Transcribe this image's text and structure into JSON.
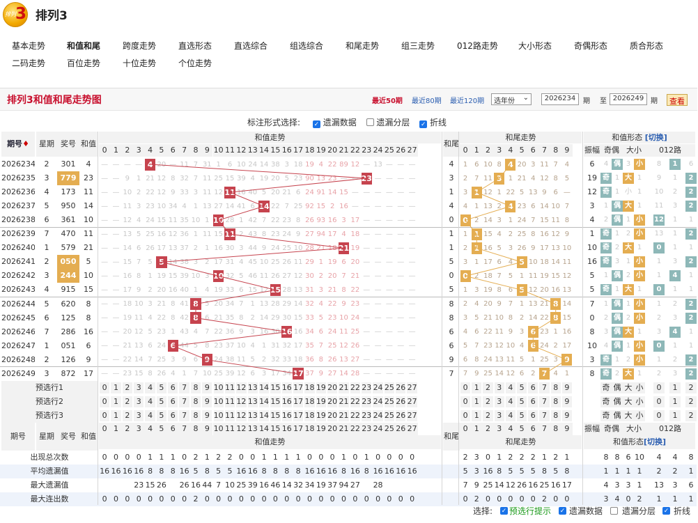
{
  "logo": {
    "text": "排列",
    "num": "3"
  },
  "title": "排列3",
  "nav": {
    "row1": [
      "基本走势",
      "和值和尾",
      "跨度走势",
      "直选形态",
      "直选综合",
      "组选综合",
      "和尾走势",
      "组三走势",
      "012路走势",
      "大小形态",
      "奇偶形态",
      "质合形态"
    ],
    "row2": [
      "二码走势",
      "百位走势",
      "十位走势",
      "个位走势"
    ],
    "active": "和值和尾"
  },
  "panel": {
    "title": "排列3和值和尾走势图",
    "links": [
      "最近50期",
      "最近80期",
      "最近120期"
    ],
    "year": "选年份",
    "from": "2026234",
    "to": "2026249",
    "qi1": "期",
    "zhi": "至",
    "qi2": "期",
    "go": "查看"
  },
  "options": {
    "label": "标注形式选择:",
    "cb1": "遗漏数据",
    "cb2": "遗漏分层",
    "cb3": "折线"
  },
  "headers": {
    "period": "期号",
    "week": "星期",
    "num": "奖号",
    "sum": "和值",
    "sumtrend": "和值走势",
    "tail": "和尾",
    "tailtrend": "和尾走势",
    "form": "和值形态",
    "switch": "[切换]",
    "amp": "振幅",
    "oddeven": "奇偶",
    "bigsmall": "大小",
    "road": "012路"
  },
  "rows": [
    {
      "p": "2026234",
      "w": "2",
      "n": "301",
      "s": "4",
      "st": [
        "—",
        "—",
        "—",
        "—",
        "4",
        "20",
        "—",
        "11",
        "7",
        "31",
        "1",
        "6",
        "10",
        "24",
        "14",
        "38",
        "3",
        "18",
        "19",
        "4",
        "22",
        "89",
        "12",
        "—",
        "13",
        "—",
        "—",
        "—"
      ],
      "t": "4",
      "tt": [
        "1",
        "6",
        "10",
        "8",
        "4",
        "20",
        "3",
        "11",
        "7",
        "4"
      ],
      "amp": "6",
      "oe": "4",
      "oep": "偶",
      "bs": "3",
      "bsp": "小",
      "r": [
        "8",
        "1",
        "6"
      ],
      "rk": 1
    },
    {
      "p": "2026235",
      "w": "3",
      "n": "779",
      "s": "23",
      "st": [
        "—",
        "—",
        "9",
        "1",
        "21",
        "12",
        "8",
        "32",
        "7",
        "11",
        "25",
        "15",
        "39",
        "4",
        "19",
        "20",
        "5",
        "23",
        "90",
        "13",
        "23",
        "—",
        "—",
        "—",
        "—",
        "—",
        "—",
        "—"
      ],
      "t": "3",
      "tt": [
        "2",
        "7",
        "11",
        "3",
        "1",
        "21",
        "4",
        "12",
        "8",
        "5"
      ],
      "amp": "19",
      "oe": "奇",
      "oep": "1",
      "bs": "大",
      "bsp": "1",
      "r": [
        "9",
        "1",
        "2"
      ],
      "rk": 2
    },
    {
      "p": "2026236",
      "w": "4",
      "n": "173",
      "s": "11",
      "st": [
        "—",
        "—",
        "10",
        "2",
        "22",
        "12",
        "9",
        "33",
        "3",
        "11",
        "12",
        "26",
        "16",
        "40",
        "5",
        "20",
        "21",
        "6",
        "24",
        "91",
        "14",
        "15",
        "—",
        "—",
        "—",
        "—",
        "—",
        "—"
      ],
      "t": "1",
      "tt": [
        "3",
        "1",
        "12",
        "1",
        "22",
        "5",
        "13",
        "9",
        "6",
        "—"
      ],
      "amp": "12",
      "oe": "奇",
      "oep": "1",
      "bs": "小",
      "bsp": "1",
      "r": [
        "10",
        "2",
        "2"
      ],
      "rk": 2
    },
    {
      "p": "2026237",
      "w": "5",
      "n": "950",
      "s": "14",
      "st": [
        "—",
        "—",
        "11",
        "3",
        "23",
        "10",
        "34",
        "4",
        "1",
        "13",
        "27",
        "14",
        "41",
        "6",
        "21",
        "22",
        "7",
        "25",
        "92",
        "15",
        "2",
        "16",
        "—",
        "—",
        "—",
        "—",
        "—",
        "—"
      ],
      "t": "4",
      "tt": [
        "4",
        "1",
        "13",
        "2",
        "4",
        "23",
        "6",
        "14",
        "10",
        "7"
      ],
      "amp": "3",
      "oe": "1",
      "oep": "偶",
      "bs": "大",
      "bsp": "1",
      "r": [
        "11",
        "3",
        "2"
      ],
      "rk": 2
    },
    {
      "p": "2026238",
      "w": "6",
      "n": "361",
      "s": "10",
      "st": [
        "—",
        "—",
        "12",
        "4",
        "24",
        "15",
        "11",
        "35",
        "10",
        "1",
        "14",
        "28",
        "1",
        "42",
        "7",
        "22",
        "23",
        "8",
        "26",
        "93",
        "16",
        "3",
        "17",
        "—",
        "—",
        "—",
        "—",
        "—"
      ],
      "t": "0",
      "tt": [
        "0",
        "2",
        "14",
        "3",
        "1",
        "24",
        "7",
        "15",
        "11",
        "8"
      ],
      "amp": "4",
      "oe": "2",
      "oep": "偶",
      "bs": "1",
      "bsp": "小",
      "r": [
        "12",
        "1",
        "1"
      ],
      "rk": 0
    },
    {
      "p": "2026239",
      "w": "7",
      "n": "470",
      "s": "11",
      "st": [
        "—",
        "—",
        "13",
        "5",
        "25",
        "16",
        "12",
        "36",
        "1",
        "11",
        "15",
        "29",
        "2",
        "43",
        "8",
        "23",
        "24",
        "9",
        "27",
        "94",
        "17",
        "4",
        "18",
        "—",
        "—",
        "—",
        "—",
        "—"
      ],
      "t": "1",
      "tt": [
        "1",
        "1",
        "15",
        "4",
        "2",
        "25",
        "8",
        "16",
        "12",
        "9"
      ],
      "amp": "1",
      "oe": "奇",
      "oep": "1",
      "bs": "2",
      "bsp": "小",
      "r": [
        "13",
        "1",
        "2"
      ],
      "rk": 2
    },
    {
      "p": "2026240",
      "w": "1",
      "n": "579",
      "s": "21",
      "st": [
        "—",
        "—",
        "14",
        "6",
        "26",
        "17",
        "13",
        "37",
        "2",
        "1",
        "16",
        "30",
        "3",
        "44",
        "9",
        "24",
        "25",
        "10",
        "28",
        "21",
        "18",
        "5",
        "19",
        "—",
        "—",
        "—",
        "—",
        "—"
      ],
      "t": "1",
      "tt": [
        "2",
        "1",
        "16",
        "5",
        "3",
        "26",
        "9",
        "17",
        "13",
        "10"
      ],
      "amp": "10",
      "oe": "奇",
      "oep": "2",
      "bs": "大",
      "bsp": "1",
      "r": [
        "0",
        "1",
        "1"
      ],
      "rk": 0
    },
    {
      "p": "2026241",
      "w": "2",
      "n": "050",
      "s": "5",
      "st": [
        "—",
        "—",
        "15",
        "7",
        "5",
        "18",
        "14",
        "38",
        "3",
        "2",
        "17",
        "31",
        "4",
        "45",
        "10",
        "25",
        "26",
        "11",
        "29",
        "1",
        "19",
        "6",
        "20",
        "—",
        "—",
        "—",
        "—",
        "—"
      ],
      "t": "5",
      "tt": [
        "3",
        "1",
        "17",
        "6",
        "4",
        "5",
        "10",
        "18",
        "14",
        "11"
      ],
      "amp": "16",
      "oe": "奇",
      "oep": "3",
      "bs": "1",
      "bsp": "小",
      "r": [
        "1",
        "3",
        "2"
      ],
      "rk": 2
    },
    {
      "p": "2026242",
      "w": "3",
      "n": "244",
      "s": "10",
      "st": [
        "—",
        "—",
        "16",
        "8",
        "1",
        "19",
        "15",
        "39",
        "10",
        "3",
        "18",
        "32",
        "5",
        "46",
        "11",
        "26",
        "27",
        "12",
        "30",
        "2",
        "20",
        "7",
        "21",
        "—",
        "—",
        "—",
        "—",
        "—"
      ],
      "t": "0",
      "tt": [
        "0",
        "2",
        "18",
        "7",
        "5",
        "1",
        "11",
        "19",
        "15",
        "12"
      ],
      "amp": "5",
      "oe": "1",
      "oep": "偶",
      "bs": "2",
      "bsp": "小",
      "r": [
        "1",
        "4",
        "1"
      ],
      "rk": 1
    },
    {
      "p": "2026243",
      "w": "4",
      "n": "915",
      "s": "15",
      "st": [
        "—",
        "—",
        "17",
        "9",
        "2",
        "20",
        "16",
        "40",
        "1",
        "4",
        "19",
        "33",
        "6",
        "15",
        "12",
        "27",
        "28",
        "13",
        "31",
        "3",
        "21",
        "8",
        "22",
        "—",
        "—",
        "—",
        "—",
        "—"
      ],
      "t": "5",
      "tt": [
        "1",
        "3",
        "19",
        "8",
        "6",
        "5",
        "12",
        "20",
        "16",
        "13"
      ],
      "amp": "5",
      "oe": "奇",
      "oep": "1",
      "bs": "大",
      "bsp": "1",
      "r": [
        "0",
        "1",
        "1"
      ],
      "rk": 0
    },
    {
      "p": "2026244",
      "w": "5",
      "n": "620",
      "s": "8",
      "st": [
        "—",
        "—",
        "18",
        "10",
        "3",
        "21",
        "8",
        "41",
        "2",
        "5",
        "20",
        "34",
        "7",
        "1",
        "13",
        "28",
        "29",
        "14",
        "32",
        "4",
        "22",
        "9",
        "23",
        "—",
        "—",
        "—",
        "—",
        "—"
      ],
      "t": "8",
      "tt": [
        "2",
        "4",
        "20",
        "9",
        "7",
        "1",
        "13",
        "21",
        "8",
        "14"
      ],
      "amp": "7",
      "oe": "1",
      "oep": "偶",
      "bs": "1",
      "bsp": "小",
      "r": [
        "1",
        "2",
        "2"
      ],
      "rk": 2
    },
    {
      "p": "2026245",
      "w": "6",
      "n": "125",
      "s": "8",
      "st": [
        "—",
        "—",
        "19",
        "11",
        "4",
        "22",
        "8",
        "42",
        "3",
        "6",
        "21",
        "35",
        "8",
        "2",
        "14",
        "29",
        "30",
        "15",
        "33",
        "5",
        "23",
        "10",
        "24",
        "—",
        "—",
        "—",
        "—",
        "—"
      ],
      "t": "8",
      "tt": [
        "3",
        "5",
        "21",
        "10",
        "8",
        "2",
        "14",
        "22",
        "8",
        "15"
      ],
      "amp": "0",
      "oe": "2",
      "oep": "偶",
      "bs": "2",
      "bsp": "小",
      "r": [
        "2",
        "3",
        "2"
      ],
      "rk": 2
    },
    {
      "p": "2026246",
      "w": "7",
      "n": "286",
      "s": "16",
      "st": [
        "—",
        "—",
        "20",
        "12",
        "5",
        "23",
        "1",
        "43",
        "4",
        "7",
        "22",
        "36",
        "9",
        "3",
        "16",
        "30",
        "31",
        "16",
        "34",
        "6",
        "24",
        "11",
        "25",
        "—",
        "—",
        "—",
        "—",
        "—"
      ],
      "t": "6",
      "tt": [
        "4",
        "6",
        "22",
        "11",
        "9",
        "3",
        "6",
        "23",
        "1",
        "16"
      ],
      "amp": "8",
      "oe": "3",
      "oep": "偶",
      "bs": "大",
      "bsp": "1",
      "r": [
        "3",
        "4",
        "1"
      ],
      "rk": 1
    },
    {
      "p": "2026247",
      "w": "1",
      "n": "051",
      "s": "6",
      "st": [
        "—",
        "—",
        "21",
        "13",
        "6",
        "24",
        "2",
        "44",
        "5",
        "8",
        "23",
        "37",
        "10",
        "4",
        "1",
        "31",
        "32",
        "17",
        "35",
        "7",
        "25",
        "12",
        "26",
        "—",
        "—",
        "—",
        "—",
        "—"
      ],
      "t": "6",
      "tt": [
        "5",
        "7",
        "23",
        "12",
        "10",
        "4",
        "6",
        "24",
        "2",
        "17"
      ],
      "amp": "10",
      "oe": "4",
      "oep": "偶",
      "bs": "1",
      "bsp": "小",
      "r": [
        "0",
        "1",
        "1"
      ],
      "rk": 0
    },
    {
      "p": "2026248",
      "w": "2",
      "n": "126",
      "s": "9",
      "st": [
        "—",
        "—",
        "22",
        "14",
        "7",
        "25",
        "3",
        "9",
        "6",
        "9",
        "24",
        "38",
        "11",
        "5",
        "2",
        "32",
        "33",
        "18",
        "36",
        "8",
        "26",
        "13",
        "27",
        "—",
        "—",
        "—",
        "—",
        "—"
      ],
      "t": "9",
      "tt": [
        "6",
        "8",
        "24",
        "13",
        "11",
        "5",
        "1",
        "25",
        "3",
        "9"
      ],
      "amp": "3",
      "oe": "奇",
      "oep": "1",
      "bs": "2",
      "bsp": "小",
      "r": [
        "1",
        "2",
        "2"
      ],
      "rk": 2
    },
    {
      "p": "2026249",
      "w": "3",
      "n": "872",
      "s": "17",
      "st": [
        "—",
        "—",
        "23",
        "15",
        "8",
        "26",
        "4",
        "1",
        "7",
        "10",
        "25",
        "39",
        "12",
        "6",
        "3",
        "17",
        "34",
        "19",
        "37",
        "9",
        "27",
        "14",
        "28",
        "—",
        "—",
        "—",
        "—",
        "—"
      ],
      "t": "7",
      "tt": [
        "7",
        "9",
        "25",
        "14",
        "12",
        "6",
        "2",
        "7",
        "4",
        "1"
      ],
      "amp": "8",
      "oe": "奇",
      "oep": "2",
      "bs": "大",
      "bsp": "1",
      "r": [
        "2",
        "3",
        "2"
      ],
      "rk": 2
    }
  ],
  "pre": [
    "预选行1",
    "预选行2",
    "预选行3"
  ],
  "stats": {
    "labels": [
      "出现总次数",
      "平均遗漏值",
      "最大遗漏值",
      "最大连出数"
    ],
    "sum": [
      [
        "0",
        "0",
        "0",
        "0",
        "1",
        "1",
        "1",
        "0",
        "2",
        "1",
        "2",
        "2",
        "0",
        "0",
        "1",
        "1",
        "1",
        "1",
        "0",
        "0",
        "0",
        "1",
        "0",
        "1",
        "0",
        "0",
        "0",
        "0"
      ],
      [
        "16",
        "16",
        "16",
        "16",
        "8",
        "8",
        "8",
        "16",
        "5",
        "8",
        "5",
        "5",
        "16",
        "16",
        "8",
        "8",
        "8",
        "8",
        "16",
        "16",
        "16",
        "8",
        "16",
        "8",
        "16",
        "16",
        "16",
        "16"
      ],
      [
        "",
        "",
        "",
        "23",
        "15",
        "26",
        "",
        "26",
        "16",
        "44",
        "7",
        "10",
        "25",
        "39",
        "16",
        "46",
        "14",
        "32",
        "34",
        "19",
        "37",
        "94",
        "27",
        "",
        "28",
        "",
        "",
        ""
      ],
      [
        "0",
        "0",
        "0",
        "0",
        "0",
        "0",
        "0",
        "0",
        "2",
        "0",
        "0",
        "0",
        "0",
        "0",
        "0",
        "0",
        "0",
        "0",
        "0",
        "0",
        "0",
        "0",
        "0",
        "0",
        "0",
        "0",
        "0",
        "0"
      ]
    ],
    "tail": [
      [
        "2",
        "3",
        "0",
        "1",
        "2",
        "2",
        "2",
        "1",
        "2",
        "1"
      ],
      [
        "5",
        "3",
        "16",
        "8",
        "5",
        "5",
        "5",
        "8",
        "5",
        "8"
      ],
      [
        "7",
        "9",
        "25",
        "14",
        "12",
        "26",
        "16",
        "25",
        "16",
        "17"
      ],
      [
        "0",
        "2",
        "0",
        "0",
        "0",
        "0",
        "0",
        "2",
        "0",
        "0"
      ]
    ],
    "form": [
      [
        "8",
        "8",
        "6",
        "10",
        "4",
        "4",
        "8"
      ],
      [
        "1",
        "1",
        "1",
        "1",
        "2",
        "2",
        "1"
      ],
      [
        "4",
        "3",
        "3",
        "1",
        "13",
        "3",
        "6"
      ],
      [
        "3",
        "4",
        "0",
        "2",
        "1",
        "1",
        "1"
      ]
    ]
  },
  "bottom": {
    "label": "选择:",
    "c1": "预选行提示",
    "c2": "遗漏数据",
    "c3": "遗漏分层",
    "c4": "折线"
  }
}
